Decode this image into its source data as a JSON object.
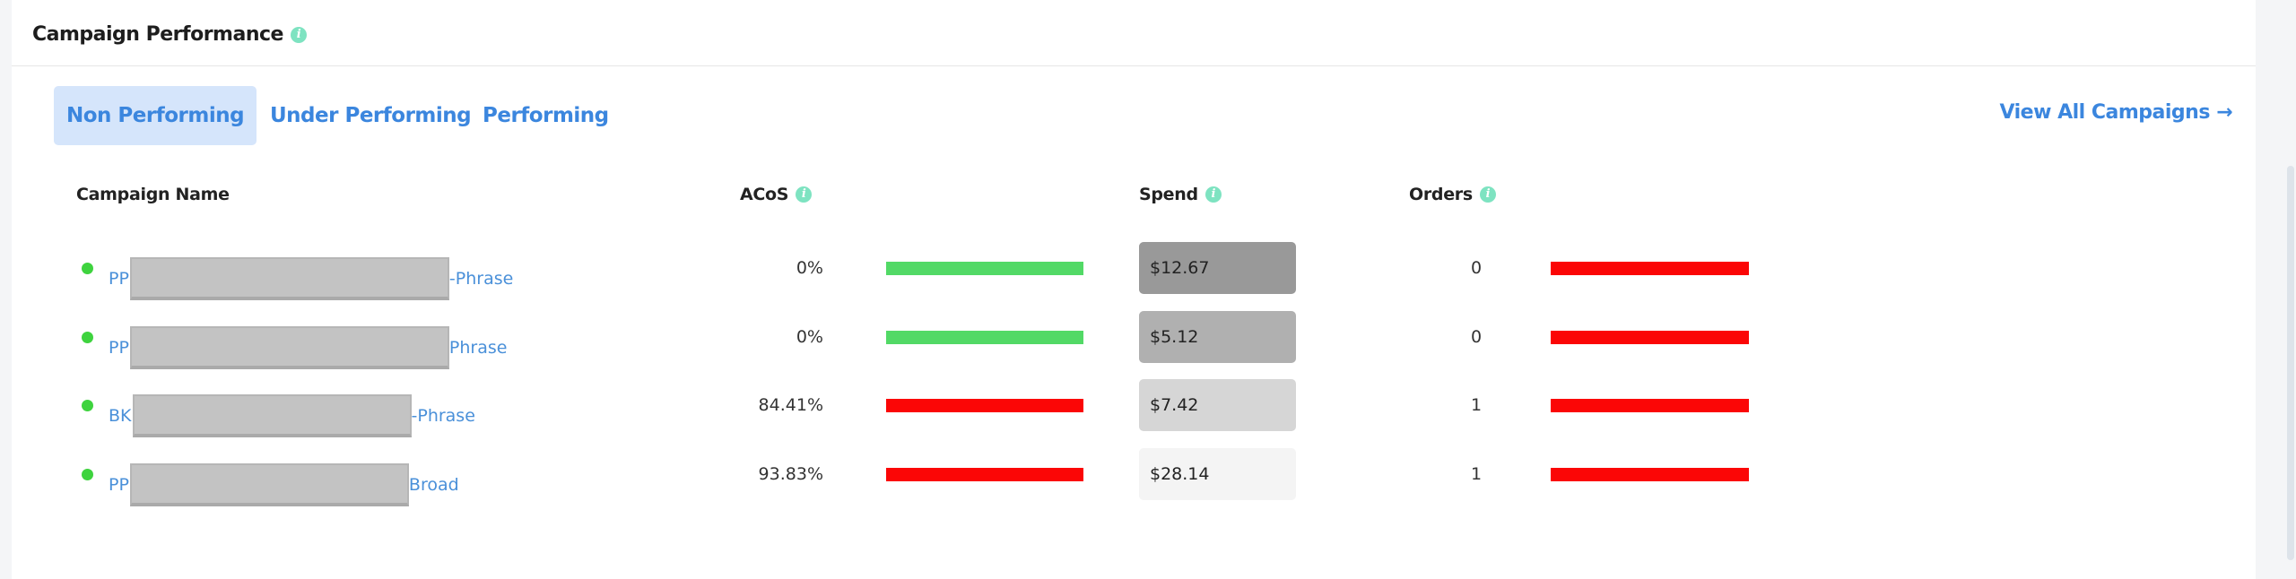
{
  "title": "Campaign Performance",
  "info_icon": "info-icon",
  "tabs": [
    {
      "label": "Non Performing",
      "active": true
    },
    {
      "label": "Under Performing",
      "active": false
    },
    {
      "label": "Performing",
      "active": false
    }
  ],
  "view_all": "View All Campaigns →",
  "columns": {
    "name": "Campaign Name",
    "acos": "ACoS",
    "spend": "Spend",
    "orders": "Orders"
  },
  "colors": {
    "good": "#52d966",
    "bad": "#fb0606",
    "link": "#3b86de",
    "status_dot": "#3ed33e"
  },
  "rows": [
    {
      "prefix": "PP",
      "suffix": "-Phrase",
      "acos": "0%",
      "acos_status": "good",
      "spend": "$12.67",
      "spend_shade": "#999999",
      "orders": "0",
      "orders_status": "bad"
    },
    {
      "prefix": "PP",
      "suffix": "Phrase",
      "acos": "0%",
      "acos_status": "good",
      "spend": "$5.12",
      "spend_shade": "#b0b0b0",
      "orders": "0",
      "orders_status": "bad"
    },
    {
      "prefix": "BK",
      "suffix": "-Phrase",
      "acos": "84.41%",
      "acos_status": "bad",
      "spend": "$7.42",
      "spend_shade": "#d6d6d6",
      "orders": "1",
      "orders_status": "bad"
    },
    {
      "prefix": "PP",
      "suffix": "Broad",
      "acos": "93.83%",
      "acos_status": "bad",
      "spend": "$28.14",
      "spend_shade": "#f4f4f4",
      "orders": "1",
      "orders_status": "bad"
    }
  ]
}
